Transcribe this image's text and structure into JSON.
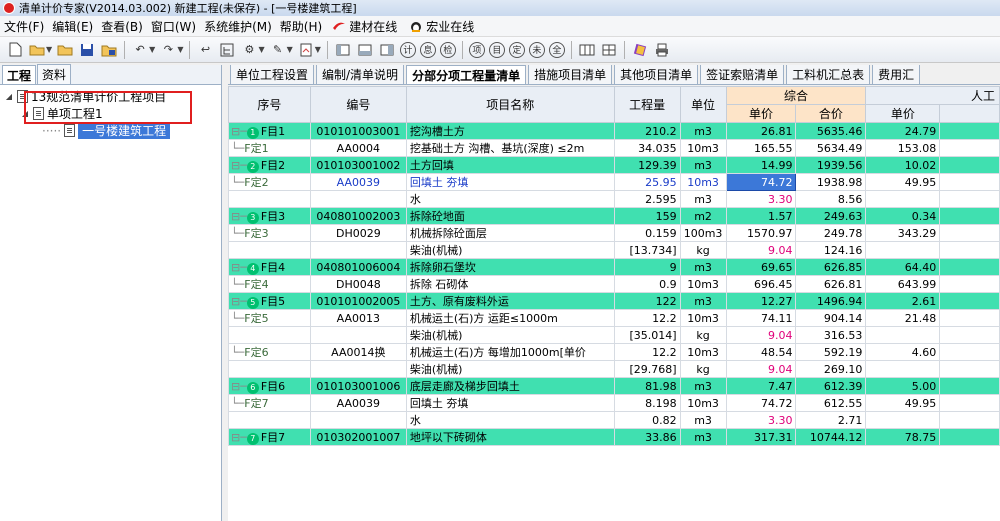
{
  "window": {
    "title": "清单计价专家(V2014.03.002) 新建工程(未保存) - [一号楼建筑工程]"
  },
  "menu": {
    "items": [
      "文件(F)",
      "编辑(E)",
      "查看(B)",
      "窗口(W)",
      "系统维护(M)",
      "帮助(H)"
    ],
    "links": [
      "建材在线",
      "宏业在线"
    ]
  },
  "left": {
    "tabs": [
      "工程",
      "资料"
    ],
    "tree": [
      {
        "label": "13规范清单计价工程项目",
        "level": 0
      },
      {
        "label": "单项工程1",
        "level": 1
      },
      {
        "label": "一号楼建筑工程",
        "level": 2,
        "selected": true
      }
    ]
  },
  "right": {
    "tabs": [
      "单位工程设置",
      "编制/清单说明",
      "分部分项工程量清单",
      "措施项目清单",
      "其他项目清单",
      "签证索赔清单",
      "工料机汇总表",
      "费用汇"
    ],
    "active_tab_index": 2
  },
  "grid": {
    "headers": {
      "seq": "序号",
      "code": "编号",
      "name": "项目名称",
      "qty": "工程量",
      "unit": "单位",
      "composite": "综合",
      "labor": "人工",
      "unit_price": "单价",
      "total": "合价",
      "labor_unit_price": "单价"
    },
    "rows": [
      {
        "type": "list",
        "marker": "1",
        "seq": "F目1",
        "code": "010101003001",
        "name": "挖沟槽土方",
        "qty": "210.2",
        "unit": "m3",
        "price": "26.81",
        "total": "5635.46",
        "labor": "24.79"
      },
      {
        "type": "quota",
        "seq": "F定1",
        "code": "AA0004",
        "name": "挖基础土方 沟槽、基坑(深度) ≤2m",
        "qty": "34.035",
        "unit": "10m3",
        "price": "165.55",
        "total": "5634.49",
        "labor": "153.08"
      },
      {
        "type": "list",
        "marker": "2",
        "seq": "F目2",
        "code": "010103001002",
        "name": "土方回填",
        "qty": "129.39",
        "unit": "m3",
        "price": "14.99",
        "total": "1939.56",
        "labor": "10.02"
      },
      {
        "type": "quota",
        "seq": "F定2",
        "code": "AA0039",
        "name": "回填土 夯填",
        "qty": "25.95",
        "unit": "10m3",
        "price": "74.72",
        "total": "1938.98",
        "labor": "49.95",
        "blue": true,
        "selected_price": true
      },
      {
        "type": "material",
        "seq": "",
        "code": "",
        "name": "水",
        "qty": "2.595",
        "unit": "m3",
        "price": "3.30",
        "total": "8.56",
        "labor": "",
        "mag": true
      },
      {
        "type": "list",
        "marker": "3",
        "seq": "F目3",
        "code": "040801002003",
        "name": "拆除砼地面",
        "qty": "159",
        "unit": "m2",
        "price": "1.57",
        "total": "249.63",
        "labor": "0.34"
      },
      {
        "type": "quota",
        "seq": "F定3",
        "code": "DH0029",
        "name": "机械拆除砼面层",
        "qty": "0.159",
        "unit": "100m3",
        "price": "1570.97",
        "total": "249.78",
        "labor": "343.29"
      },
      {
        "type": "material",
        "seq": "",
        "code": "",
        "name": "柴油(机械)",
        "qty": "[13.734]",
        "unit": "kg",
        "price": "9.04",
        "total": "124.16",
        "labor": "",
        "mag": true
      },
      {
        "type": "list",
        "marker": "4",
        "seq": "F目4",
        "code": "040801006004",
        "name": "拆除卵石堡坎",
        "qty": "9",
        "unit": "m3",
        "price": "69.65",
        "total": "626.85",
        "labor": "64.40"
      },
      {
        "type": "quota",
        "seq": "F定4",
        "code": "DH0048",
        "name": "拆除 石砌体",
        "qty": "0.9",
        "unit": "10m3",
        "price": "696.45",
        "total": "626.81",
        "labor": "643.99"
      },
      {
        "type": "list",
        "marker": "5",
        "seq": "F目5",
        "code": "010101002005",
        "name": "土方、原有废料外运",
        "qty": "122",
        "unit": "m3",
        "price": "12.27",
        "total": "1496.94",
        "labor": "2.61"
      },
      {
        "type": "quota",
        "seq": "F定5",
        "code": "AA0013",
        "name": "机械运土(石)方 运距≤1000m",
        "qty": "12.2",
        "unit": "10m3",
        "price": "74.11",
        "total": "904.14",
        "labor": "21.48"
      },
      {
        "type": "material",
        "seq": "",
        "code": "",
        "name": "柴油(机械)",
        "qty": "[35.014]",
        "unit": "kg",
        "price": "9.04",
        "total": "316.53",
        "labor": "",
        "mag": true
      },
      {
        "type": "quota",
        "seq": "F定6",
        "code": "AA0014换",
        "name": "机械运土(石)方 每增加1000m[单价",
        "qty": "12.2",
        "unit": "10m3",
        "price": "48.54",
        "total": "592.19",
        "labor": "4.60"
      },
      {
        "type": "material",
        "seq": "",
        "code": "",
        "name": "柴油(机械)",
        "qty": "[29.768]",
        "unit": "kg",
        "price": "9.04",
        "total": "269.10",
        "labor": "",
        "mag": true
      },
      {
        "type": "list",
        "marker": "6",
        "seq": "F目6",
        "code": "010103001006",
        "name": "底层走廊及梯步回填土",
        "qty": "81.98",
        "unit": "m3",
        "price": "7.47",
        "total": "612.39",
        "labor": "5.00"
      },
      {
        "type": "quota",
        "seq": "F定7",
        "code": "AA0039",
        "name": "回填土 夯填",
        "qty": "8.198",
        "unit": "10m3",
        "price": "74.72",
        "total": "612.55",
        "labor": "49.95"
      },
      {
        "type": "material",
        "seq": "",
        "code": "",
        "name": "水",
        "qty": "0.82",
        "unit": "m3",
        "price": "3.30",
        "total": "2.71",
        "labor": "",
        "mag": true
      },
      {
        "type": "list",
        "marker": "7",
        "seq": "F目7",
        "code": "010302001007",
        "name": "地坪以下砖砌体",
        "qty": "33.86",
        "unit": "m3",
        "price": "317.31",
        "total": "10744.12",
        "labor": "78.75"
      }
    ]
  }
}
